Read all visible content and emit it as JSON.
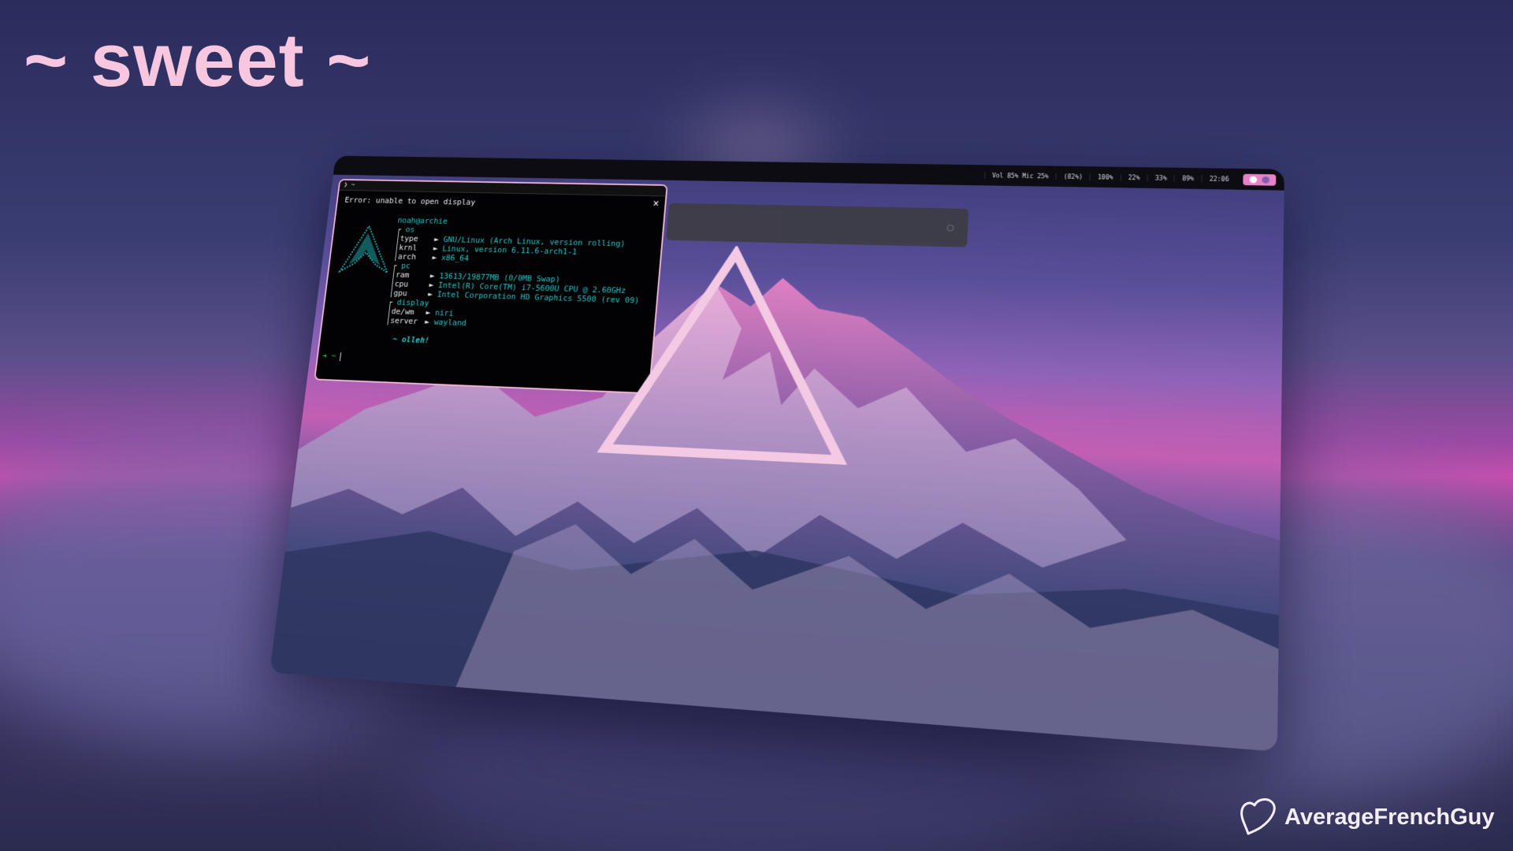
{
  "page": {
    "title": "~ sweet ~",
    "watermark": "AverageFrenchGuy"
  },
  "colors": {
    "accent_pink": "#f7c6df",
    "terminal_teal": "#24c6c6",
    "terminal_border": "#f2b6d6",
    "bar_bg": "#0c0c12",
    "workspace_pill": "#e682c8"
  },
  "topbar": {
    "stats": [
      "Vol 85% Mic 25%",
      "(82%)",
      "100%",
      "22%",
      "33%",
      "89%",
      "22:06"
    ],
    "workspaces": [
      "active",
      "inactive"
    ]
  },
  "terminal": {
    "title": "❯ ~",
    "close_icon": "close-icon",
    "error": "Error: unable to open display",
    "user": "noah",
    "host": "@archie",
    "groups": {
      "os": "os",
      "pc": "pc",
      "display": "display"
    },
    "rows": {
      "type": {
        "key": "type",
        "value": "GNU/Linux (Arch Linux, version rolling)"
      },
      "krnl": {
        "key": "krnl",
        "value": "Linux, version 6.11.6-arch1-1"
      },
      "arch": {
        "key": "arch",
        "value": "x86_64"
      },
      "ram": {
        "key": "ram",
        "value": "13613/19877MB (0/0MB Swap)"
      },
      "cpu": {
        "key": "cpu",
        "value": "Intel(R) Core(TM) i7-5600U CPU @ 2.60GHz"
      },
      "gpu": {
        "key": "gpu",
        "value": "Intel Corporation HD Graphics 5500 (rev 09)"
      },
      "dewm": {
        "key": "de/wm",
        "value": "niri"
      },
      "server": {
        "key": "server",
        "value": "wayland"
      }
    },
    "arrow": "►",
    "greeting": "~ olleh!",
    "prompt": "➜  ~"
  }
}
